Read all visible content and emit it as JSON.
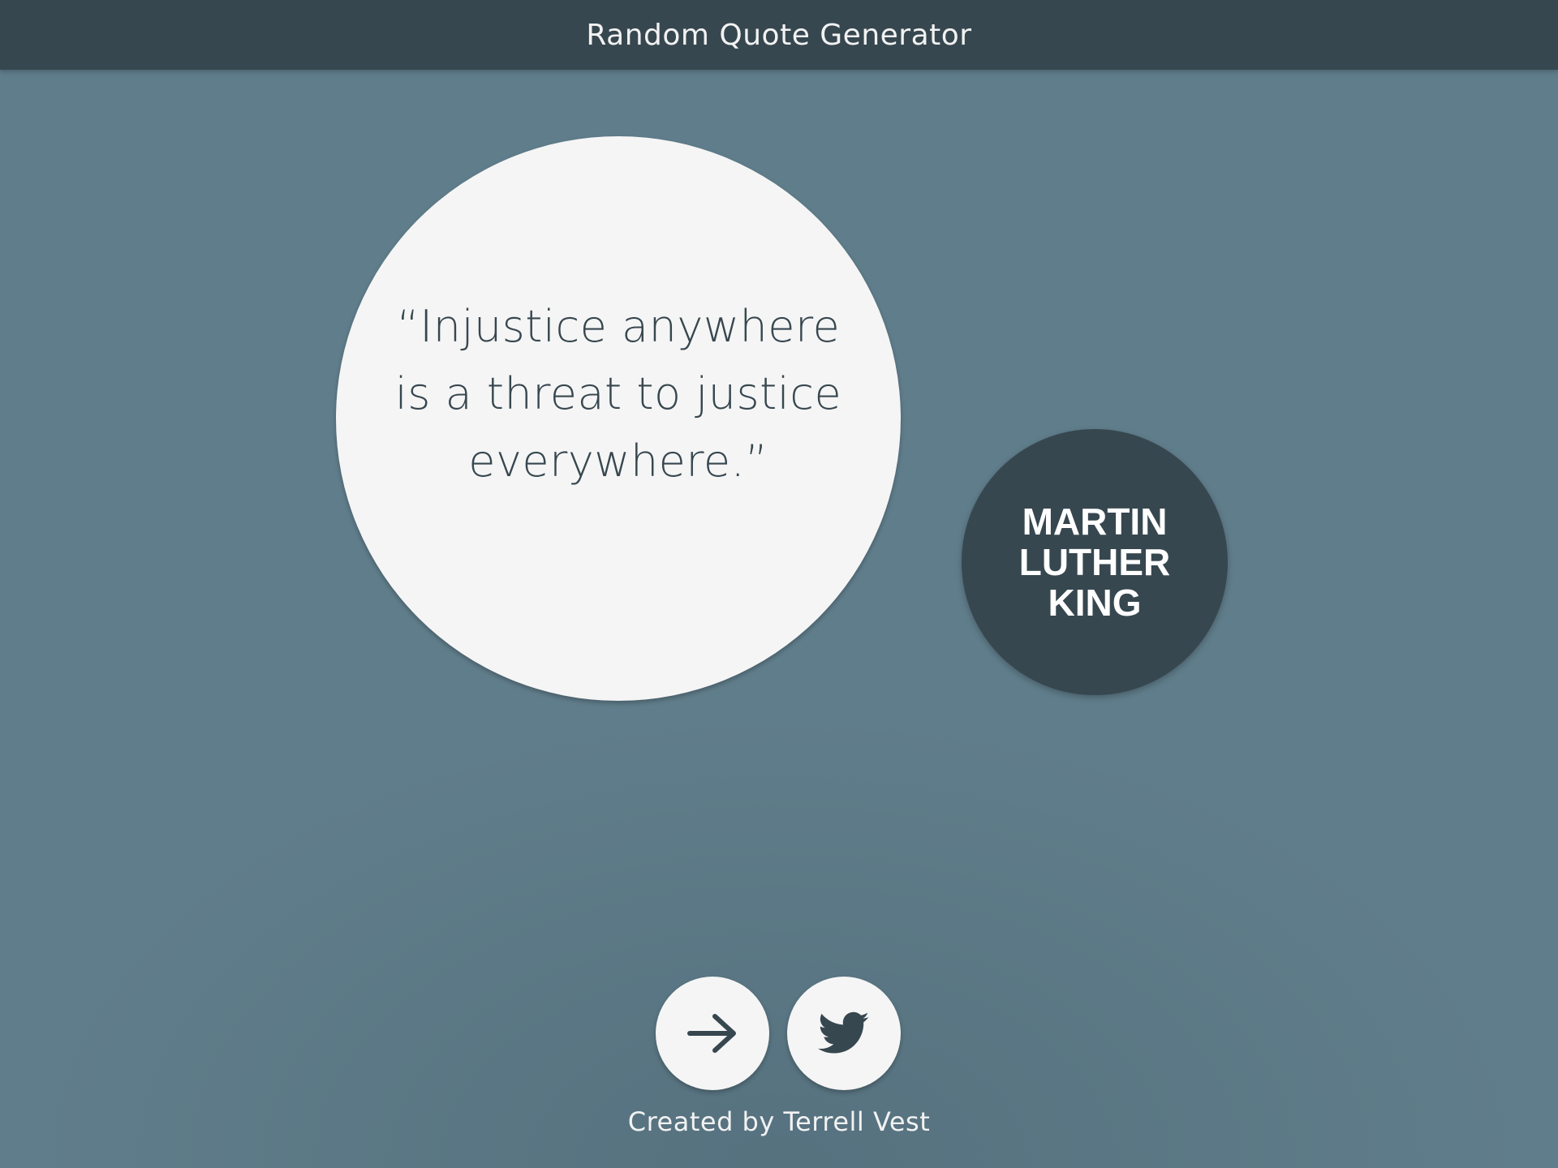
{
  "header": {
    "title": "Random Quote Generator"
  },
  "quote": {
    "text": "“Injustice anywhere is a threat to justice everywhere.”",
    "author": "Martin Luther King"
  },
  "actions": {
    "next_icon": "arrow-right-icon",
    "tweet_icon": "twitter-bird-icon"
  },
  "footer": {
    "credit": "Created by Terrell Vest"
  },
  "colors": {
    "background": "#607d8b",
    "header": "#37474f",
    "quote_circle": "#f5f5f5",
    "author_circle": "#37474f",
    "text_dark": "#37474f",
    "text_light": "#f2f2f2"
  }
}
